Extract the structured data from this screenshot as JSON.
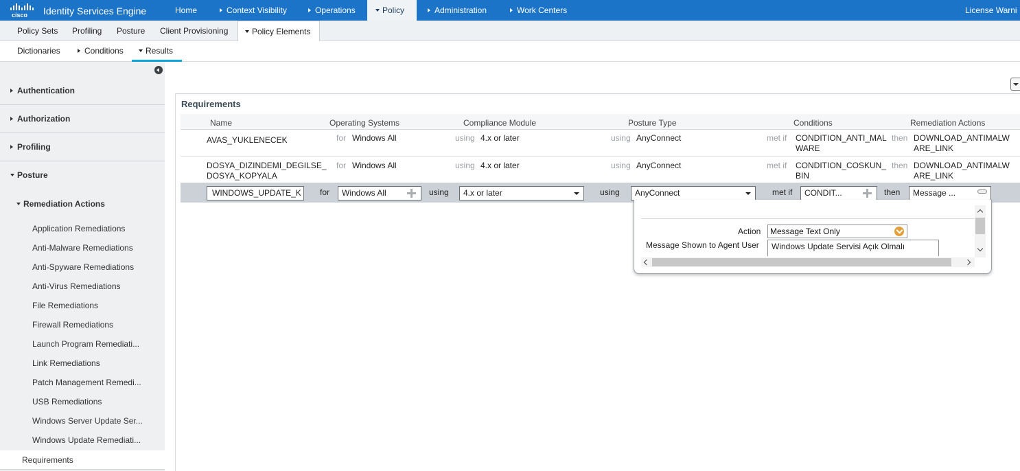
{
  "colors": {
    "brand_blue": "#1b74c7",
    "accent_cyan": "#0ca4d9",
    "edit_row_bg": "#cbd1d6",
    "action_icon": "#e1a03c"
  },
  "header": {
    "logo_text": "cisco",
    "app_title": "Identity Services Engine",
    "nav": [
      "Home",
      "Context Visibility",
      "Operations",
      "Policy",
      "Administration",
      "Work Centers"
    ],
    "active_nav": "Policy",
    "license": "License Warni"
  },
  "subnav": {
    "items": [
      "Policy Sets",
      "Profiling",
      "Posture",
      "Client Provisioning",
      "Policy Elements"
    ],
    "active": "Policy Elements"
  },
  "thirdnav": {
    "items": [
      "Dictionaries",
      "Conditions",
      "Results"
    ],
    "active": "Results"
  },
  "sidebar": {
    "sections": [
      "Authentication",
      "Authorization",
      "Profiling",
      "Posture"
    ],
    "subsection": "Remediation Actions",
    "items": [
      "Application Remediations",
      "Anti-Malware Remediations",
      "Anti-Spyware Remediations",
      "Anti-Virus Remediations",
      "File Remediations",
      "Firewall Remediations",
      "Launch Program Remediati...",
      "Link Remediations",
      "Patch Management Remedi...",
      "USB Remediations",
      "Windows Server Update Ser...",
      "Windows Update Remediati..."
    ],
    "selected": "Requirements"
  },
  "requirements": {
    "title": "Requirements",
    "columns": [
      "Name",
      "Operating Systems",
      "Compliance Module",
      "Posture Type",
      "Conditions",
      "Remediation Actions"
    ],
    "keywords": {
      "for": "for",
      "using": "using",
      "met_if": "met if",
      "then": "then"
    },
    "rows": [
      {
        "name": "AVAS_YUKLENECEK",
        "os": "Windows All",
        "module": "4.x or later",
        "posture_type": "AnyConnect",
        "conditions": "CONDITION_ANTI_MAL\nWARE",
        "remediation": "DOWNLOAD_ANTIMALW\nARE_LINK"
      },
      {
        "name": "DOSYA_DIZINDEMI_DEGILSE_\nDOSYA_KOPYALA",
        "os": "Windows All",
        "module": "4.x or later",
        "posture_type": "AnyConnect",
        "conditions": "CONDITION_COSKUN_\nBIN",
        "remediation": "DOWNLOAD_ANTIMALW\nARE_LINK"
      }
    ],
    "edit_row": {
      "name_value": "WINDOWS_UPDATE_K",
      "os_value": "Windows All",
      "module_value": "4.x or later",
      "posture_type_value": "AnyConnect",
      "conditions_value": "CONDIT...",
      "remediation_value": "Message ..."
    }
  },
  "popup": {
    "action_label": "Action",
    "action_value": "Message Text Only",
    "message_label": "Message Shown to Agent User",
    "message_value": "Windows Update Servisi Açık Olmalı"
  }
}
